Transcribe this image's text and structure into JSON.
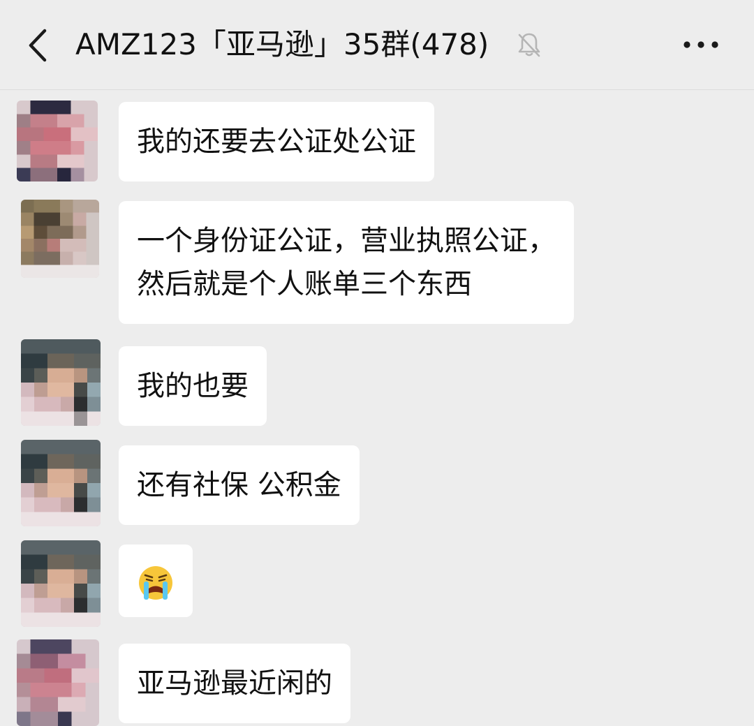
{
  "header": {
    "back_icon": "chevron-left-icon",
    "title": "AMZ123「亚马逊」35群(478)",
    "mute_icon": "bell-muted-icon",
    "more_icon": "more-dots-icon"
  },
  "messages": [
    {
      "lines": [
        "我的还要去公证处公证"
      ]
    },
    {
      "lines": [
        "一个身份证公证，营业执照公证，",
        "然后就是个人账单三个东西"
      ]
    },
    {
      "lines": [
        "我的也要"
      ]
    },
    {
      "lines": [
        "还有社保 公积金"
      ]
    },
    {
      "emoji": "crying-face-emoji"
    },
    {
      "lines": [
        "亚马逊最近闲的"
      ]
    }
  ]
}
